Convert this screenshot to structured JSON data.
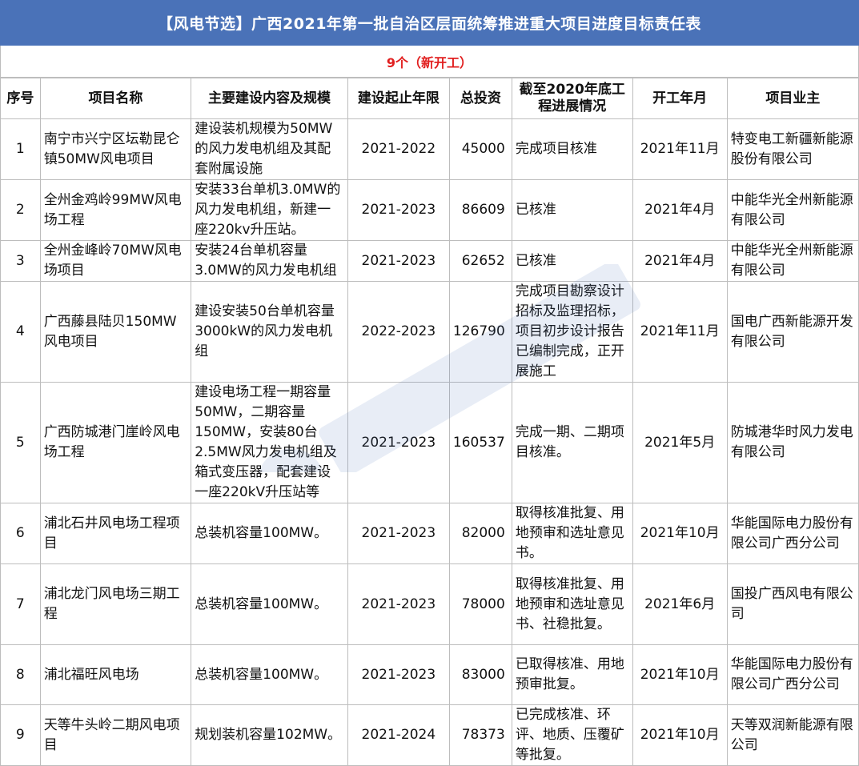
{
  "header": {
    "title": "【风电节选】广西2021年第一批自治区层面统筹推进重大项目进度目标责任表",
    "subtitle": "9个（新开工）"
  },
  "table": {
    "columns": [
      "序号",
      "项目名称",
      "主要建设内容及规模",
      "建设起止年限",
      "总投资",
      "截至2020年底工程进展情况",
      "开工年月",
      "项目业主"
    ],
    "rows": [
      {
        "no": "1",
        "name": "南宁市兴宁区坛勒昆仑镇50MW风电项目",
        "content": "建设装机规模为50MW的风力发电机组及其配套附属设施",
        "years": "2021-2022",
        "investment": "45000",
        "progress": "完成项目核准",
        "start": "2021年11月",
        "owner": "特变电工新疆新能源股份有限公司"
      },
      {
        "no": "2",
        "name": "全州金鸡岭99MW风电场工程",
        "content": "安装33台单机3.0MW的风力发电机组，新建一座220kv升压站。",
        "years": "2021-2023",
        "investment": "86609",
        "progress": "已核准",
        "start": "2021年4月",
        "owner": "中能华光全州新能源有限公司"
      },
      {
        "no": "3",
        "name": "全州金峰岭70MW风电场项目",
        "content": "安装24台单机容量3.0MW的风力发电机组",
        "years": "2021-2023",
        "investment": "62652",
        "progress": "已核准",
        "start": "2021年4月",
        "owner": "中能华光全州新能源有限公司"
      },
      {
        "no": "4",
        "name": "广西藤县陆贝150MW风电项目",
        "content": "建设安装50台单机容量3000kW的风力发电机组",
        "years": "2022-2023",
        "investment": "126790",
        "progress": "完成项目勘察设计招标及监理招标，项目初步设计报告已编制完成，正开展施工",
        "start": "2021年11月",
        "owner": "国电广西新能源开发有限公司"
      },
      {
        "no": "5",
        "name": "广西防城港门崖岭风电场工程",
        "content": "建设电场工程一期容量50MW，二期容量150MW，安装80台2.5MW风力发电机组及箱式变压器，配套建设一座220kV升压站等",
        "years": "2021-2023",
        "investment": "160537",
        "progress": "完成一期、二期项目核准。",
        "start": "2021年5月",
        "owner": "防城港华时风力发电有限公司"
      },
      {
        "no": "6",
        "name": "浦北石井风电场工程项目",
        "content": "总装机容量100MW。",
        "years": "2021-2023",
        "investment": "82000",
        "progress": "取得核准批复、用地预审和选址意见书。",
        "start": "2021年10月",
        "owner": "华能国际电力股份有限公司广西分公司"
      },
      {
        "no": "7",
        "name": "浦北龙门风电场三期工程",
        "content": "总装机容量100MW。",
        "years": "2021-2023",
        "investment": "78000",
        "progress": "取得核准批复、用地预审和选址意见书、社稳批复。",
        "start": "2021年6月",
        "owner": "国投广西风电有限公司"
      },
      {
        "no": "8",
        "name": "浦北福旺风电场",
        "content": "总装机容量100MW。",
        "years": "2021-2023",
        "investment": "83000",
        "progress": "已取得核准、用地预审批复。",
        "start": "2021年10月",
        "owner": "华能国际电力股份有限公司广西分公司"
      },
      {
        "no": "9",
        "name": "天等牛头岭二期风电项目",
        "content": "规划装机容量102MW。",
        "years": "2021-2024",
        "investment": "78373",
        "progress": "已完成核准、环评、地质、压覆矿等批复。",
        "start": "2021年10月",
        "owner": "天等双润新能源有限公司"
      }
    ]
  },
  "colors": {
    "title_bg": "#4a72b8",
    "subtitle_text": "#e11f1f",
    "grid": "#bdbdbd"
  }
}
